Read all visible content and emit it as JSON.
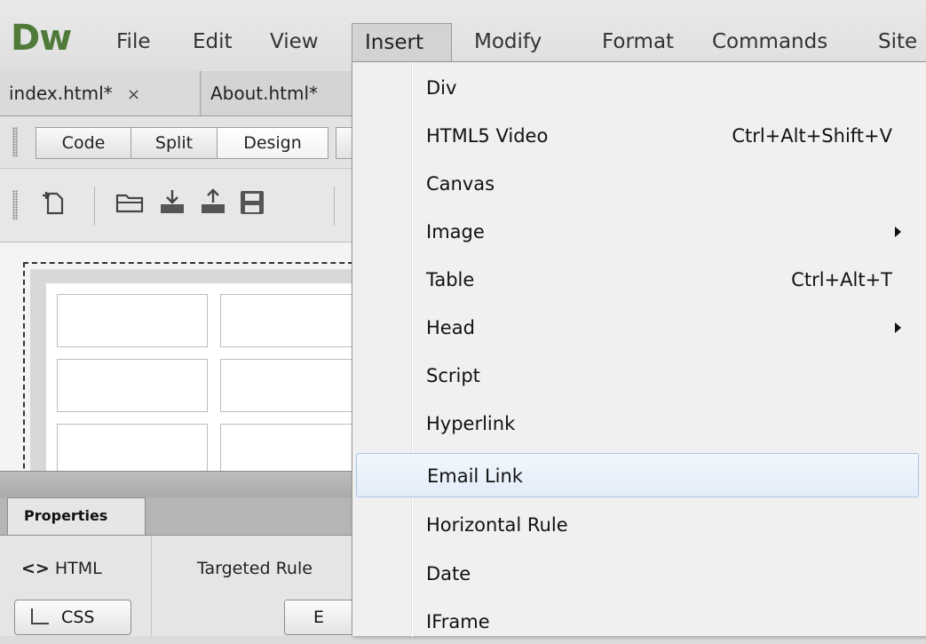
{
  "app": {
    "logo": "Dw"
  },
  "menubar": {
    "items": [
      "File",
      "Edit",
      "View",
      "Insert",
      "Modify",
      "Format",
      "Commands",
      "Site"
    ],
    "active": "Insert"
  },
  "document_tabs": [
    {
      "label": "index.html*",
      "close": "×"
    },
    {
      "label": "About.html*"
    }
  ],
  "view_buttons": [
    "Code",
    "Split",
    "Design"
  ],
  "toolbar_icons": [
    "new-document-icon",
    "open-folder-icon",
    "get-file-icon",
    "put-file-icon",
    "save-icon"
  ],
  "properties": {
    "tab_label": "Properties",
    "html_label": "HTML",
    "css_label": "CSS",
    "targeted_rule_label": "Targeted Rule",
    "edit_button_label": "E"
  },
  "insert_menu": {
    "items": [
      {
        "label": "Div",
        "shortcut": ""
      },
      {
        "label": "HTML5 Video",
        "shortcut": "Ctrl+Alt+Shift+V"
      },
      {
        "label": "Canvas",
        "shortcut": ""
      },
      {
        "label": "Image",
        "shortcut": "",
        "submenu": true
      },
      {
        "label": "Table",
        "shortcut": "Ctrl+Alt+T"
      },
      {
        "label": "Head",
        "shortcut": "",
        "submenu": true
      },
      {
        "label": "Script",
        "shortcut": ""
      },
      {
        "label": "Hyperlink",
        "shortcut": ""
      },
      {
        "label": "Email Link",
        "shortcut": "",
        "highlighted": true
      },
      {
        "label": "Horizontal Rule",
        "shortcut": ""
      },
      {
        "label": "Date",
        "shortcut": ""
      },
      {
        "label": "IFrame",
        "shortcut": ""
      }
    ]
  },
  "colors": {
    "logo": "#4f7a3a",
    "highlight_border": "#a8c4e4",
    "menu_bg": "#f0f0f0"
  }
}
